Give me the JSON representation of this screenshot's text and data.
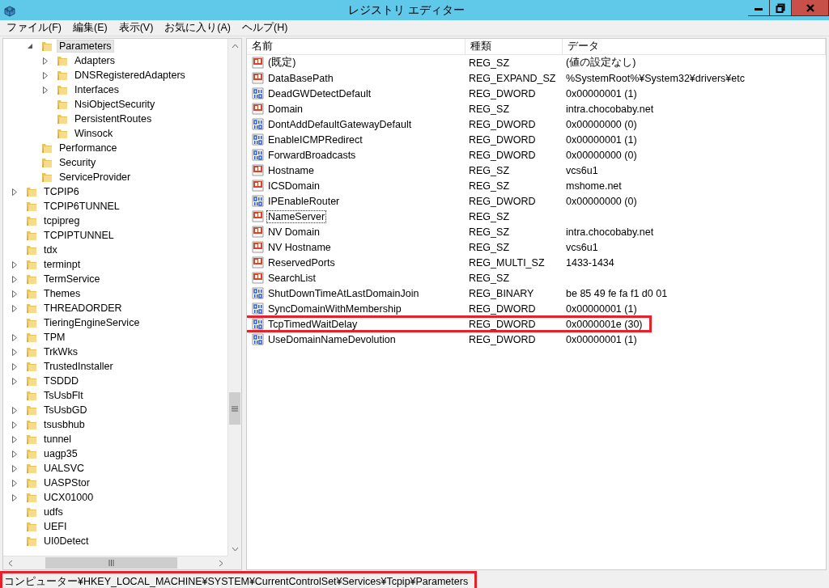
{
  "window": {
    "title": "レジストリ エディター"
  },
  "menu": [
    "ファイル(F)",
    "編集(E)",
    "表示(V)",
    "お気に入り(A)",
    "ヘルプ(H)"
  ],
  "tree": {
    "items": [
      {
        "children": [
          {
            "label": "Parameters",
            "has_children": true,
            "expanded": true,
            "selected": true,
            "children": [
              {
                "label": "Adapters",
                "has_children": true,
                "expanded": false,
                "selected": false
              },
              {
                "label": "DNSRegisteredAdapters",
                "has_children": true,
                "expanded": false,
                "selected": false
              },
              {
                "label": "Interfaces",
                "has_children": true,
                "expanded": false,
                "selected": false
              },
              {
                "label": "NsiObjectSecurity",
                "has_children": false,
                "selected": false
              },
              {
                "label": "PersistentRoutes",
                "has_children": false,
                "selected": false
              },
              {
                "label": "Winsock",
                "has_children": false,
                "selected": false
              }
            ]
          },
          {
            "label": "Performance",
            "has_children": false,
            "selected": false
          },
          {
            "label": "Security",
            "has_children": false,
            "selected": false
          },
          {
            "label": "ServiceProvider",
            "has_children": false,
            "selected": false
          }
        ]
      },
      {
        "label": "TCPIP6",
        "has_children": true,
        "expanded": false,
        "selected": false
      },
      {
        "label": "TCPIP6TUNNEL",
        "has_children": false,
        "selected": false
      },
      {
        "label": "tcpipreg",
        "has_children": false,
        "selected": false
      },
      {
        "label": "TCPIPTUNNEL",
        "has_children": false,
        "selected": false
      },
      {
        "label": "tdx",
        "has_children": false,
        "selected": false
      },
      {
        "label": "terminpt",
        "has_children": true,
        "expanded": false,
        "selected": false
      },
      {
        "label": "TermService",
        "has_children": true,
        "expanded": false,
        "selected": false
      },
      {
        "label": "Themes",
        "has_children": true,
        "expanded": false,
        "selected": false
      },
      {
        "label": "THREADORDER",
        "has_children": true,
        "expanded": false,
        "selected": false
      },
      {
        "label": "TieringEngineService",
        "has_children": false,
        "selected": false
      },
      {
        "label": "TPM",
        "has_children": true,
        "expanded": false,
        "selected": false
      },
      {
        "label": "TrkWks",
        "has_children": true,
        "expanded": false,
        "selected": false
      },
      {
        "label": "TrustedInstaller",
        "has_children": true,
        "expanded": false,
        "selected": false
      },
      {
        "label": "TSDDD",
        "has_children": true,
        "expanded": false,
        "selected": false
      },
      {
        "label": "TsUsbFlt",
        "has_children": false,
        "selected": false
      },
      {
        "label": "TsUsbGD",
        "has_children": true,
        "expanded": false,
        "selected": false
      },
      {
        "label": "tsusbhub",
        "has_children": true,
        "expanded": false,
        "selected": false
      },
      {
        "label": "tunnel",
        "has_children": true,
        "expanded": false,
        "selected": false
      },
      {
        "label": "uagp35",
        "has_children": true,
        "expanded": false,
        "selected": false
      },
      {
        "label": "UALSVC",
        "has_children": true,
        "expanded": false,
        "selected": false
      },
      {
        "label": "UASPStor",
        "has_children": true,
        "expanded": false,
        "selected": false
      },
      {
        "label": "UCX01000",
        "has_children": true,
        "expanded": false,
        "selected": false
      },
      {
        "label": "udfs",
        "has_children": false,
        "selected": false
      },
      {
        "label": "UEFI",
        "has_children": false,
        "selected": false
      },
      {
        "label": "UI0Detect",
        "has_children": false,
        "selected": false
      }
    ]
  },
  "table": {
    "columns": [
      "名前",
      "種類",
      "データ"
    ],
    "rows": [
      {
        "kind": "string",
        "name": "(既定)",
        "type": "REG_SZ",
        "data": "(値の設定なし)",
        "focused": false,
        "highlighted": false
      },
      {
        "kind": "string",
        "name": "DataBasePath",
        "type": "REG_EXPAND_SZ",
        "data": "%SystemRoot%¥System32¥drivers¥etc",
        "focused": false,
        "highlighted": false
      },
      {
        "kind": "binary",
        "name": "DeadGWDetectDefault",
        "type": "REG_DWORD",
        "data": "0x00000001 (1)",
        "focused": false,
        "highlighted": false
      },
      {
        "kind": "string",
        "name": "Domain",
        "type": "REG_SZ",
        "data": "intra.chocobaby.net",
        "focused": false,
        "highlighted": false
      },
      {
        "kind": "binary",
        "name": "DontAddDefaultGatewayDefault",
        "type": "REG_DWORD",
        "data": "0x00000000 (0)",
        "focused": false,
        "highlighted": false
      },
      {
        "kind": "binary",
        "name": "EnableICMPRedirect",
        "type": "REG_DWORD",
        "data": "0x00000001 (1)",
        "focused": false,
        "highlighted": false
      },
      {
        "kind": "binary",
        "name": "ForwardBroadcasts",
        "type": "REG_DWORD",
        "data": "0x00000000 (0)",
        "focused": false,
        "highlighted": false
      },
      {
        "kind": "string",
        "name": "Hostname",
        "type": "REG_SZ",
        "data": "vcs6u1",
        "focused": false,
        "highlighted": false
      },
      {
        "kind": "string",
        "name": "ICSDomain",
        "type": "REG_SZ",
        "data": "mshome.net",
        "focused": false,
        "highlighted": false
      },
      {
        "kind": "binary",
        "name": "IPEnableRouter",
        "type": "REG_DWORD",
        "data": "0x00000000 (0)",
        "focused": false,
        "highlighted": false
      },
      {
        "kind": "string",
        "name": "NameServer",
        "type": "REG_SZ",
        "focused": true,
        "highlighted": false
      },
      {
        "kind": "string",
        "name": "NV Domain",
        "type": "REG_SZ",
        "data": "intra.chocobaby.net",
        "focused": false,
        "highlighted": false
      },
      {
        "kind": "string",
        "name": "NV Hostname",
        "type": "REG_SZ",
        "data": "vcs6u1",
        "focused": false,
        "highlighted": false
      },
      {
        "kind": "string",
        "name": "ReservedPorts",
        "type": "REG_MULTI_SZ",
        "data": "1433-1434",
        "focused": false,
        "highlighted": false
      },
      {
        "kind": "string",
        "name": "SearchList",
        "type": "REG_SZ",
        "focused": false,
        "highlighted": false
      },
      {
        "kind": "binary",
        "name": "ShutDownTimeAtLastDomainJoin",
        "type": "REG_BINARY",
        "data": "be 85 49 fe fa f1 d0 01",
        "focused": false,
        "highlighted": false
      },
      {
        "kind": "binary",
        "name": "SyncDomainWithMembership",
        "type": "REG_DWORD",
        "data": "0x00000001 (1)",
        "focused": false,
        "highlighted": false
      },
      {
        "kind": "binary",
        "name": "TcpTimedWaitDelay",
        "type": "REG_DWORD",
        "data": "0x0000001e (30)",
        "focused": false,
        "highlighted": true
      },
      {
        "kind": "binary",
        "name": "UseDomainNameDevolution",
        "type": "REG_DWORD",
        "data": "0x00000001 (1)",
        "focused": false,
        "highlighted": false
      }
    ]
  },
  "status_bar": {
    "path": "コンピューター¥HKEY_LOCAL_MACHINE¥SYSTEM¥CurrentControlSet¥Services¥Tcpip¥Parameters",
    "highlighted": true
  }
}
